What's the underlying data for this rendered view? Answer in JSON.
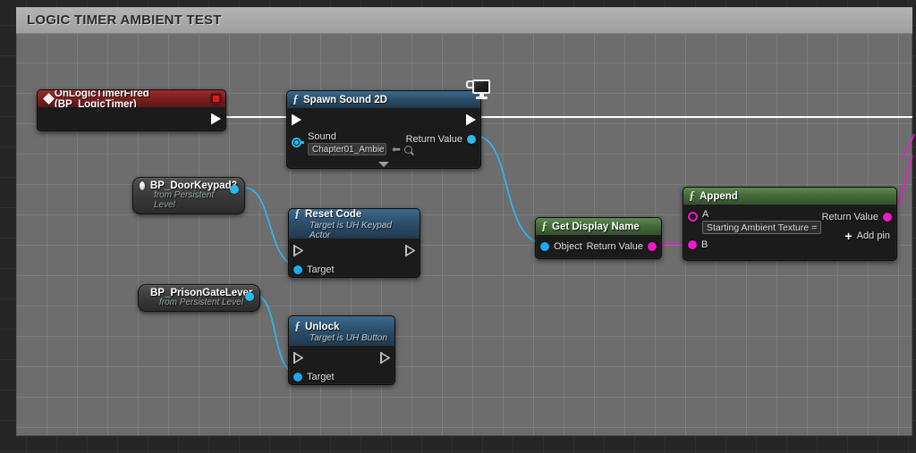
{
  "window": {
    "title": "LOGIC TIMER AMBIENT TEST"
  },
  "colors": {
    "canvas_bg": "#6d6d6d",
    "outer_bg": "#262626",
    "exec_wire": "#ffffff",
    "object_wire": "#2bb8ee",
    "string_wire": "#ee19c8",
    "event_header": "#7d2020",
    "function_header": "#2c4f6b",
    "pure_function_header": "#476b3d"
  },
  "nodes": {
    "event": {
      "title": "OnLogicTimerFired (BP_LogicTimer)",
      "icon": "event-diamond-icon",
      "stop_button": "stop-recording-button"
    },
    "spawn_sound": {
      "title": "Spawn Sound 2D",
      "icon": "function-f-icon",
      "exec_in": "",
      "exec_out": "",
      "sound_pin_label": "Sound",
      "sound_value": "Chapter01_Ambie",
      "return_label": "Return Value",
      "badge": "display-monitor-icon",
      "advanced_caret": "expand-advanced-pins"
    },
    "reset_code": {
      "title": "Reset Code",
      "subtitle": "Target is UH Keypad Actor",
      "icon": "function-f-icon",
      "target_label": "Target"
    },
    "unlock": {
      "title": "Unlock",
      "subtitle": "Target is UH Button",
      "icon": "function-f-icon",
      "target_label": "Target"
    },
    "get_display_name": {
      "title": "Get Display Name",
      "icon": "function-f-icon",
      "object_label": "Object",
      "return_label": "Return Value"
    },
    "append": {
      "title": "Append",
      "icon": "function-f-icon",
      "pin_a_label": "A",
      "pin_a_value": "Starting Ambient Texture =",
      "pin_b_label": "B",
      "return_label": "Return Value",
      "add_pin_label": "Add pin",
      "add_pin_icon": "plus-icon"
    },
    "var_door_keypad": {
      "title": "BP_DoorKeypad3",
      "subtitle": "from Persistent Level",
      "icon": "object-reference-icon"
    },
    "var_prison_lever": {
      "title": "BP_PrisonGateLever",
      "subtitle": "from Persistent Level",
      "icon": "object-reference-icon"
    }
  }
}
